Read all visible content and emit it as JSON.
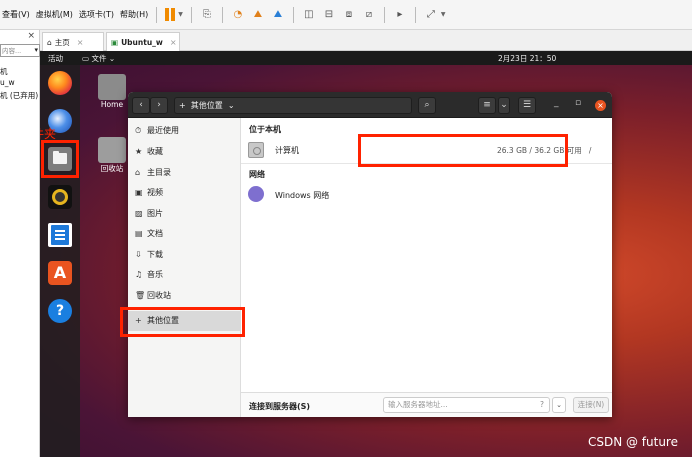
{
  "vmware": {
    "menu": [
      "查看(V)",
      "虚拟机(M)",
      "选项卡(T)",
      "帮助(H)"
    ],
    "library": {
      "close": "×",
      "search_placeholder": "内容...",
      "items": [
        "机",
        "u_w",
        "机 (已弃用)"
      ]
    },
    "tabs": [
      {
        "label": "主页",
        "icon": "home-icon"
      },
      {
        "label": "Ubuntu_w",
        "icon": "vm-icon"
      }
    ]
  },
  "ubuntu": {
    "activities": "活动",
    "files_menu": "文件",
    "clock": "2月23日 21：50",
    "dock_annotation": "文件夹",
    "desktop": [
      {
        "label": "Home",
        "icon": "home-folder-icon"
      },
      {
        "label": "回收站",
        "icon": "trash-icon"
      }
    ],
    "watermark": "CSDN @ future"
  },
  "nautilus": {
    "location": "其他位置",
    "sidebar": [
      {
        "glyph": "⏱",
        "label": "最近使用"
      },
      {
        "glyph": "★",
        "label": "收藏"
      },
      {
        "glyph": "⌂",
        "label": "主目录"
      },
      {
        "glyph": "▣",
        "label": "视频"
      },
      {
        "glyph": "▨",
        "label": "图片"
      },
      {
        "glyph": "▤",
        "label": "文档"
      },
      {
        "glyph": "⇩",
        "label": "下载"
      },
      {
        "glyph": "♫",
        "label": "音乐"
      },
      {
        "glyph": "🗑",
        "label": "回收站"
      },
      {
        "glyph": "+",
        "label": "其他位置"
      }
    ],
    "section_local": "位于本机",
    "computer": {
      "label": "计算机",
      "info": "26.3 GB / 36.2 GB 可用",
      "mount": "/"
    },
    "section_network": "网络",
    "network": {
      "label": "Windows 网络"
    },
    "connect_label": "连接到服务器(S)",
    "server_placeholder": "输入服务器地址...",
    "connect_button": "连接(N)"
  },
  "colors": {
    "accent": "#e95420",
    "annotation": "#ff2200"
  }
}
